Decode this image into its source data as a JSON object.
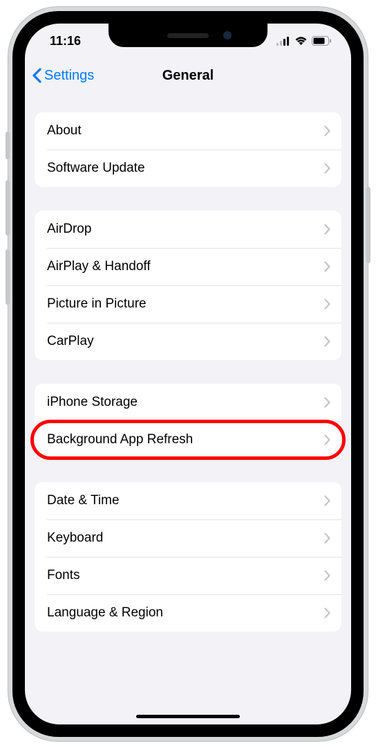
{
  "status": {
    "time": "11:16"
  },
  "nav": {
    "back_label": "Settings",
    "title": "General"
  },
  "groups": [
    {
      "rows": [
        {
          "id": "about",
          "label": "About"
        },
        {
          "id": "software-update",
          "label": "Software Update"
        }
      ]
    },
    {
      "rows": [
        {
          "id": "airdrop",
          "label": "AirDrop"
        },
        {
          "id": "airplay-handoff",
          "label": "AirPlay & Handoff"
        },
        {
          "id": "picture-in-picture",
          "label": "Picture in Picture"
        },
        {
          "id": "carplay",
          "label": "CarPlay"
        }
      ]
    },
    {
      "rows": [
        {
          "id": "iphone-storage",
          "label": "iPhone Storage"
        },
        {
          "id": "background-app-refresh",
          "label": "Background App Refresh",
          "highlighted": true
        }
      ]
    },
    {
      "rows": [
        {
          "id": "date-time",
          "label": "Date & Time"
        },
        {
          "id": "keyboard",
          "label": "Keyboard"
        },
        {
          "id": "fonts",
          "label": "Fonts"
        },
        {
          "id": "language-region",
          "label": "Language & Region"
        }
      ]
    }
  ]
}
